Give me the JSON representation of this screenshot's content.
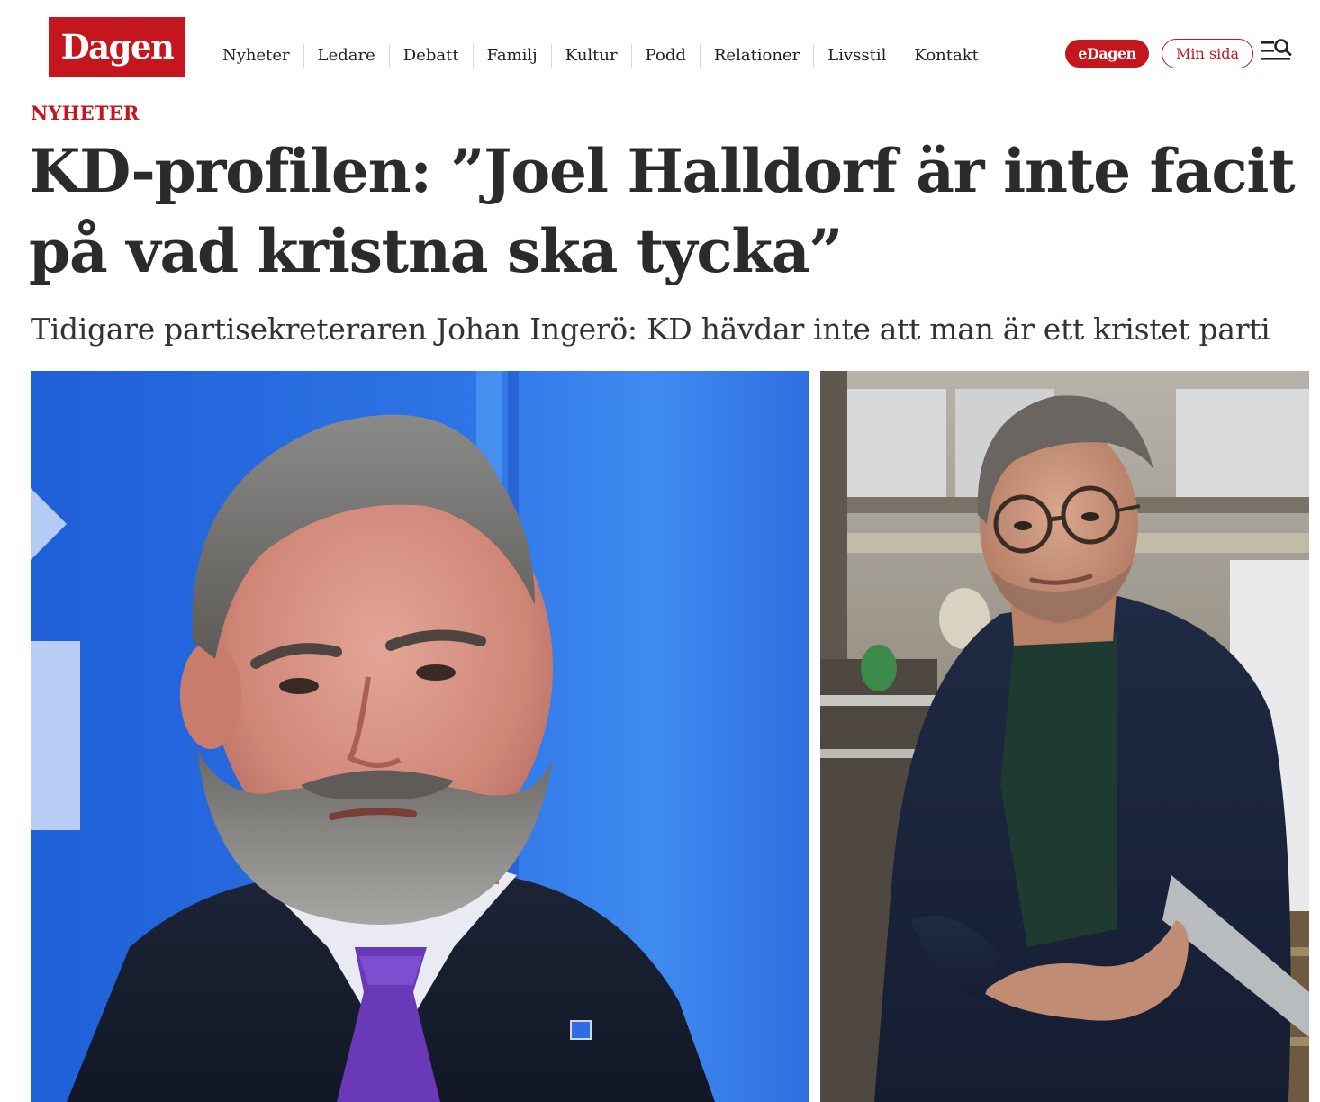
{
  "brand": {
    "logo_text": "Dagen",
    "accent_color": "#c4161c"
  },
  "nav": {
    "items": [
      {
        "label": "Nyheter"
      },
      {
        "label": "Ledare"
      },
      {
        "label": "Debatt"
      },
      {
        "label": "Familj"
      },
      {
        "label": "Kultur"
      },
      {
        "label": "Podd"
      },
      {
        "label": "Relationer"
      },
      {
        "label": "Livsstil"
      },
      {
        "label": "Kontakt"
      }
    ]
  },
  "header_actions": {
    "edagen_label": "eDagen",
    "minsida_label": "Min sida",
    "menu_icon": "menu-search-icon"
  },
  "article": {
    "kicker": "NYHETER",
    "headline": "KD-profilen: ”Joel Halldorf är inte facit på vad kristna ska tycka”",
    "subhead": "Tidigare partisekreteraren Johan Ingerö: KD hävdar inte att man är ett kristet parti"
  }
}
